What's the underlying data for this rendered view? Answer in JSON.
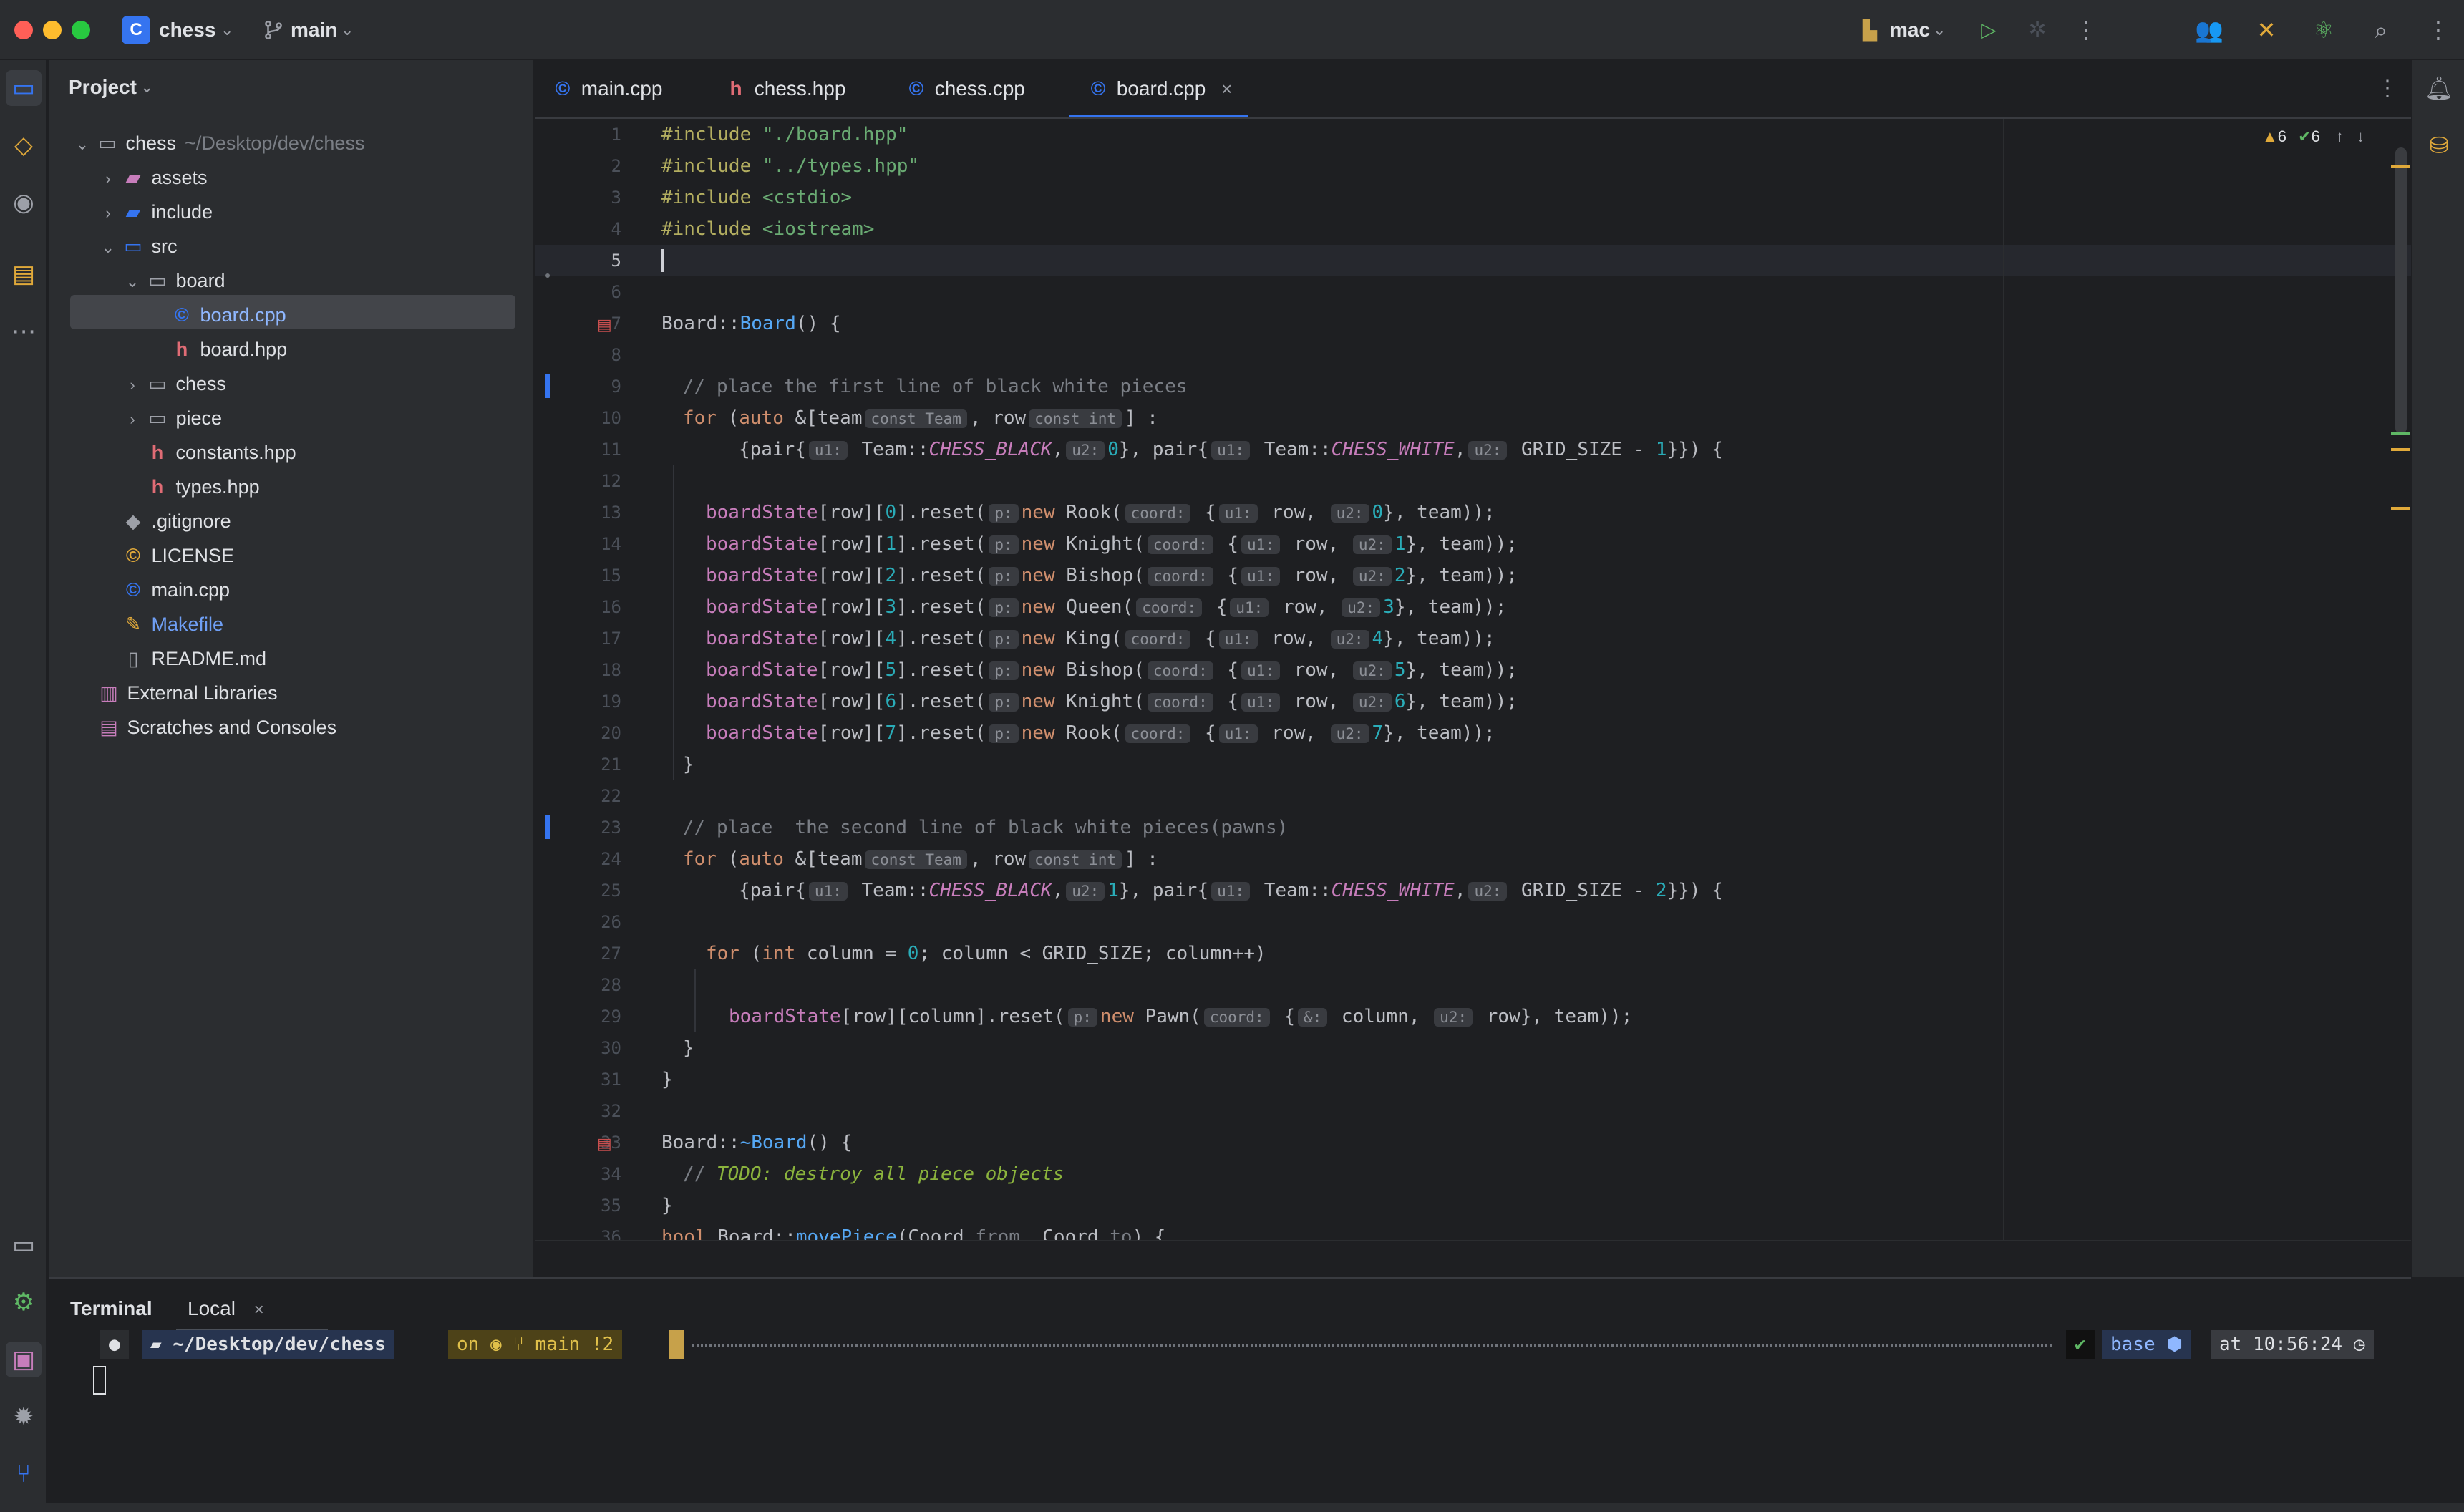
{
  "titlebar": {
    "project_badge": "C",
    "project_name": "chess",
    "branch_name": "main",
    "run_config": "mac"
  },
  "project_panel": {
    "title": "Project",
    "tree": [
      {
        "label": "chess",
        "path": "~/Desktop/dev/chess",
        "type": "root"
      },
      {
        "label": "assets",
        "type": "folder"
      },
      {
        "label": "include",
        "type": "folder"
      },
      {
        "label": "src",
        "type": "folder"
      },
      {
        "label": "board",
        "type": "folder"
      },
      {
        "label": "board.cpp",
        "type": "cpp",
        "selected": true
      },
      {
        "label": "board.hpp",
        "type": "hpp"
      },
      {
        "label": "chess",
        "type": "folder"
      },
      {
        "label": "piece",
        "type": "folder"
      },
      {
        "label": "constants.hpp",
        "type": "hpp"
      },
      {
        "label": "types.hpp",
        "type": "hpp"
      },
      {
        "label": ".gitignore",
        "type": "git"
      },
      {
        "label": "LICENSE",
        "type": "license"
      },
      {
        "label": "main.cpp",
        "type": "cpp"
      },
      {
        "label": "Makefile",
        "type": "make"
      },
      {
        "label": "README.md",
        "type": "md"
      },
      {
        "label": "External Libraries",
        "type": "lib"
      },
      {
        "label": "Scratches and Consoles",
        "type": "scratch"
      }
    ]
  },
  "tabs": [
    {
      "label": "main.cpp",
      "icon": "cpp-file-icon"
    },
    {
      "label": "chess.hpp",
      "icon": "hpp-file-icon"
    },
    {
      "label": "chess.cpp",
      "icon": "cpp-file-icon"
    },
    {
      "label": "board.cpp",
      "icon": "cpp-file-icon",
      "active": true
    }
  ],
  "inspections": {
    "warnings": "6",
    "ok": "6"
  },
  "editor": {
    "line_numbers": [
      "1",
      "2",
      "3",
      "4",
      "5",
      "6",
      "7",
      "8",
      "9",
      "10",
      "11",
      "12",
      "13",
      "14",
      "15",
      "16",
      "17",
      "18",
      "19",
      "20",
      "21",
      "22",
      "23",
      "24",
      "25",
      "26",
      "27",
      "28",
      "29",
      "30",
      "31",
      "32",
      "33",
      "34",
      "35",
      "36"
    ],
    "lines": {
      "l1": [
        "#include ",
        "\"./board.hpp\""
      ],
      "l2": [
        "#include ",
        "\"../types.hpp\""
      ],
      "l3": [
        "#include ",
        "<cstdio>"
      ],
      "l4": [
        "#include ",
        "<iostream>"
      ],
      "l7": [
        "Board",
        "::",
        "Board",
        "() {"
      ],
      "l9": "// place the first line of black white pieces",
      "l10": [
        "for",
        " (",
        "auto",
        " &[team",
        "const Team",
        ", row",
        "const int",
        "] :"
      ],
      "l11": [
        "{pair{",
        "u1:",
        " Team::",
        "CHESS_BLACK",
        ",",
        "u2:",
        "0",
        "}, pair{",
        "u1:",
        " Team::",
        "CHESS_WHITE",
        ",",
        "u2:",
        " GRID_SIZE - ",
        "1",
        "}}) {"
      ],
      "l13": [
        "boardState",
        "[row][",
        "0",
        "].reset(",
        "p:",
        "new",
        " Rook(",
        "coord:",
        " {",
        "u1:",
        " row, ",
        "u2:",
        "0",
        "}, team));"
      ],
      "l14": [
        "boardState",
        "[row][",
        "1",
        "].reset(",
        "p:",
        "new",
        " Knight(",
        "coord:",
        " {",
        "u1:",
        " row, ",
        "u2:",
        "1",
        "}, team));"
      ],
      "l15": [
        "boardState",
        "[row][",
        "2",
        "].reset(",
        "p:",
        "new",
        " Bishop(",
        "coord:",
        " {",
        "u1:",
        " row, ",
        "u2:",
        "2",
        "}, team));"
      ],
      "l16": [
        "boardState",
        "[row][",
        "3",
        "].reset(",
        "p:",
        "new",
        " Queen(",
        "coord:",
        " {",
        "u1:",
        " row, ",
        "u2:",
        "3",
        "}, team));"
      ],
      "l17": [
        "boardState",
        "[row][",
        "4",
        "].reset(",
        "p:",
        "new",
        " King(",
        "coord:",
        " {",
        "u1:",
        " row, ",
        "u2:",
        "4",
        "}, team));"
      ],
      "l18": [
        "boardState",
        "[row][",
        "5",
        "].reset(",
        "p:",
        "new",
        " Bishop(",
        "coord:",
        " {",
        "u1:",
        " row, ",
        "u2:",
        "5",
        "}, team));"
      ],
      "l19": [
        "boardState",
        "[row][",
        "6",
        "].reset(",
        "p:",
        "new",
        " Knight(",
        "coord:",
        " {",
        "u1:",
        " row, ",
        "u2:",
        "6",
        "}, team));"
      ],
      "l20": [
        "boardState",
        "[row][",
        "7",
        "].reset(",
        "p:",
        "new",
        " Rook(",
        "coord:",
        " {",
        "u1:",
        " row, ",
        "u2:",
        "7",
        "}, team));"
      ],
      "l21": "}",
      "l23": "// place  the second line of black white pieces(pawns)",
      "l24": [
        "for",
        " (",
        "auto",
        " &[team",
        "const Team",
        ", row",
        "const int",
        "] :"
      ],
      "l25": [
        "{pair{",
        "u1:",
        " Team::",
        "CHESS_BLACK",
        ",",
        "u2:",
        "1",
        "}, pair{",
        "u1:",
        " Team::",
        "CHESS_WHITE",
        ",",
        "u2:",
        " GRID_SIZE - ",
        "2",
        "}}) {"
      ],
      "l27": [
        "for",
        " (",
        "int",
        " column = ",
        "0",
        "; column < GRID_SIZE; column++)"
      ],
      "l29": [
        "boardState",
        "[row][column].reset(",
        "p:",
        "new",
        " Pawn(",
        "coord:",
        " {",
        "&:",
        " column, ",
        "u2:",
        " row}, team));"
      ],
      "l30": "}",
      "l31": "}",
      "l33": [
        "Board",
        "::",
        "~Board",
        "() {"
      ],
      "l34": [
        "// ",
        "TODO: destroy all piece objects"
      ],
      "l35": "}",
      "l36": [
        "bool",
        " Board::",
        "movePiece",
        "(Coord ",
        "from",
        ", Coord ",
        "to",
        ") {"
      ]
    }
  },
  "terminal": {
    "tab_title": "Terminal",
    "session_tab": "Local",
    "prompt": {
      "path": "~/Desktop/dev/chess",
      "on": "on",
      "branch": "main !2",
      "status": "✔",
      "env": "base",
      "time": "at 10:56:24"
    }
  },
  "colors": {
    "accent": "#3574f0",
    "background": "#1e1f22",
    "panel": "#2b2d30",
    "selection": "#43454a"
  }
}
